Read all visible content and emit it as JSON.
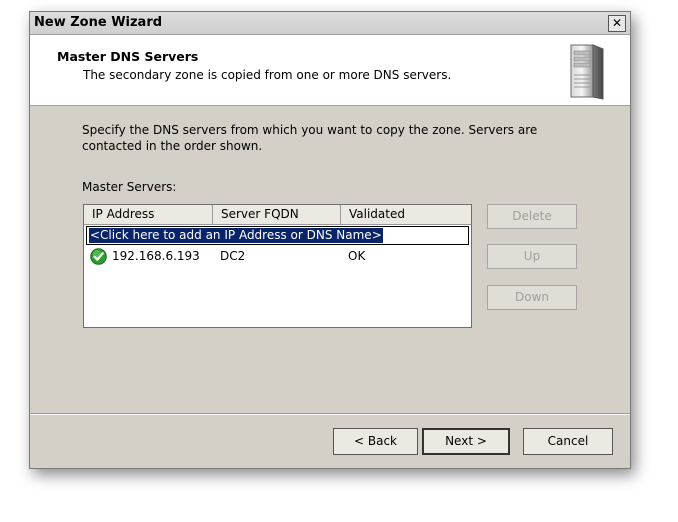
{
  "window": {
    "title": "New Zone Wizard",
    "close_glyph": "✕"
  },
  "header": {
    "title": "Master DNS Servers",
    "subtitle": "The secondary zone is copied from one or more DNS servers.",
    "icon": "server-icon"
  },
  "body": {
    "description": "Specify the DNS servers from which you want to copy the zone.  Servers are contacted in the order shown.",
    "master_servers_label": "Master Servers:"
  },
  "list": {
    "columns": [
      "IP Address",
      "Server FQDN",
      "Validated"
    ],
    "add_prompt": "<Click here to add an IP Address or DNS Name>",
    "rows": [
      {
        "ip": "192.168.6.193",
        "fqdn": "DC2",
        "validated": "OK",
        "icon": "check-ok-icon",
        "status_color": "#2e9e2e"
      }
    ]
  },
  "side_buttons": {
    "delete": "Delete",
    "up": "Up",
    "down": "Down"
  },
  "footer": {
    "back": "< Back",
    "next": "Next >",
    "cancel": "Cancel"
  }
}
